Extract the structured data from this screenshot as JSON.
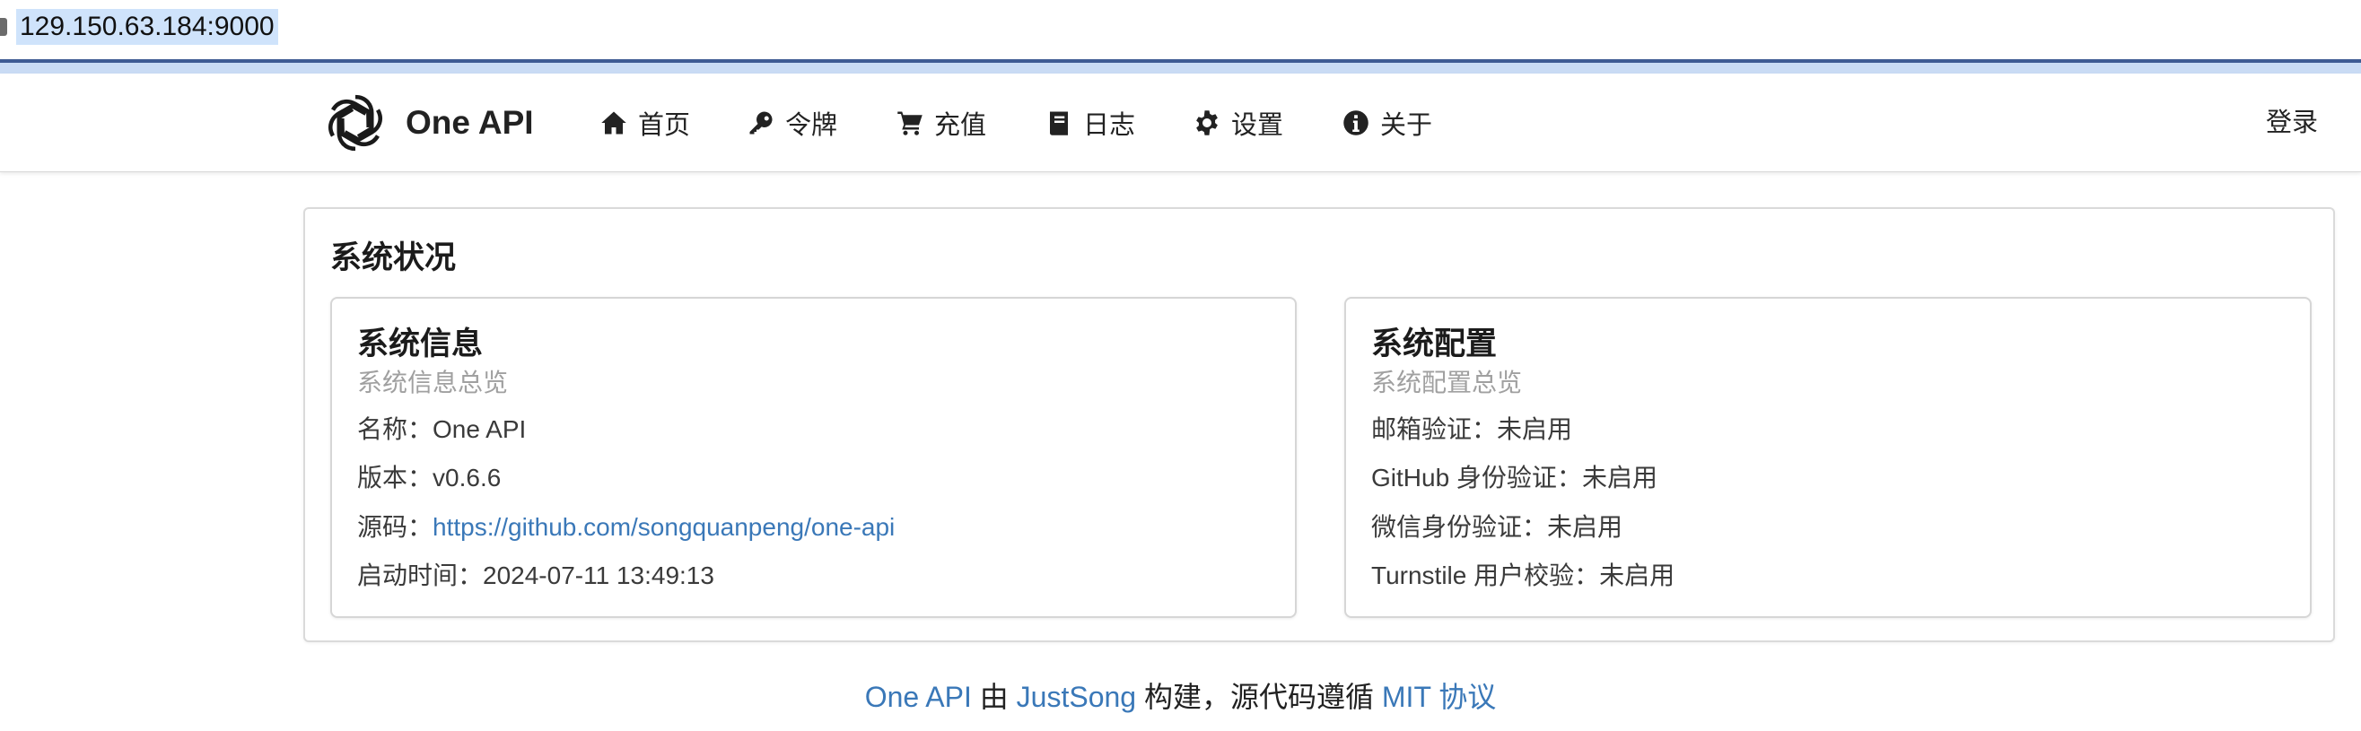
{
  "browser": {
    "url": "129.150.63.184:9000"
  },
  "navbar": {
    "brand": "One API",
    "items": [
      {
        "label": "首页",
        "icon": "home-icon"
      },
      {
        "label": "令牌",
        "icon": "key-icon"
      },
      {
        "label": "充值",
        "icon": "cart-icon"
      },
      {
        "label": "日志",
        "icon": "book-icon"
      },
      {
        "label": "设置",
        "icon": "gear-icon"
      },
      {
        "label": "关于",
        "icon": "info-icon"
      }
    ],
    "login": "登录"
  },
  "status": {
    "title": "系统状况",
    "system_info": {
      "title": "系统信息",
      "subtitle": "系统信息总览",
      "name_label": "名称：",
      "name_value": "One API",
      "version_label": "版本：",
      "version_value": "v0.6.6",
      "source_label": "源码：",
      "source_value": "https://github.com/songquanpeng/one-api",
      "start_label": "启动时间：",
      "start_value": "2024-07-11 13:49:13"
    },
    "system_config": {
      "title": "系统配置",
      "subtitle": "系统配置总览",
      "email_label": "邮箱验证：",
      "email_value": "未启用",
      "github_label": "GitHub 身份验证：",
      "github_value": "未启用",
      "wechat_label": "微信身份验证：",
      "wechat_value": "未启用",
      "turnstile_label": "Turnstile 用户校验：",
      "turnstile_value": "未启用"
    }
  },
  "footer": {
    "project": "One API",
    "by": " 由 ",
    "author": "JustSong",
    "middle": " 构建，源代码遵循 ",
    "license": "MIT 协议"
  },
  "colors": {
    "link": "#3a78b8",
    "accent_line": "#3e5b93",
    "accent_band": "#c9dbf4",
    "url_highlight": "#cfe3fb"
  }
}
